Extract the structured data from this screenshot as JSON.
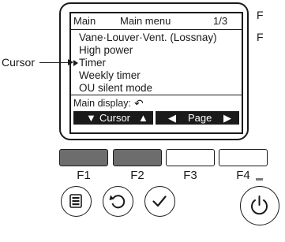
{
  "callout": {
    "cursor_label": "Cursor"
  },
  "side_text": {
    "line1": "F",
    "line2": "F"
  },
  "lcd": {
    "header": {
      "left": "Main",
      "center": "Main menu",
      "page": "1/3"
    },
    "menu_items": [
      {
        "label": "Vane·Louver·Vent. (Lossnay)"
      },
      {
        "label": "High power"
      },
      {
        "label": "Timer"
      },
      {
        "label": "Weekly timer"
      },
      {
        "label": "OU silent mode"
      }
    ],
    "selected_index": 2,
    "status": {
      "label": "Main display:",
      "icon": "return-icon"
    },
    "softkeys": {
      "cursor_down": "▼",
      "cursor_label": "Cursor",
      "cursor_up": "▲",
      "page_prev": "◀",
      "page_label": "Page",
      "page_next": "▶"
    }
  },
  "function_buttons": [
    {
      "label": "F1",
      "state": "dark"
    },
    {
      "label": "F2",
      "state": "dark"
    },
    {
      "label": "F3",
      "state": "light"
    },
    {
      "label": "F4",
      "state": "light"
    }
  ],
  "round_buttons": [
    {
      "name": "menu-button",
      "icon": "menu-icon"
    },
    {
      "name": "return-button",
      "icon": "return-icon"
    },
    {
      "name": "select-button",
      "icon": "checkmark-icon"
    },
    {
      "name": "power-button",
      "icon": "power-icon"
    }
  ],
  "colors": {
    "ink": "#1a1a1a",
    "pressed_button": "#6d6d6d",
    "background": "#ffffff"
  }
}
